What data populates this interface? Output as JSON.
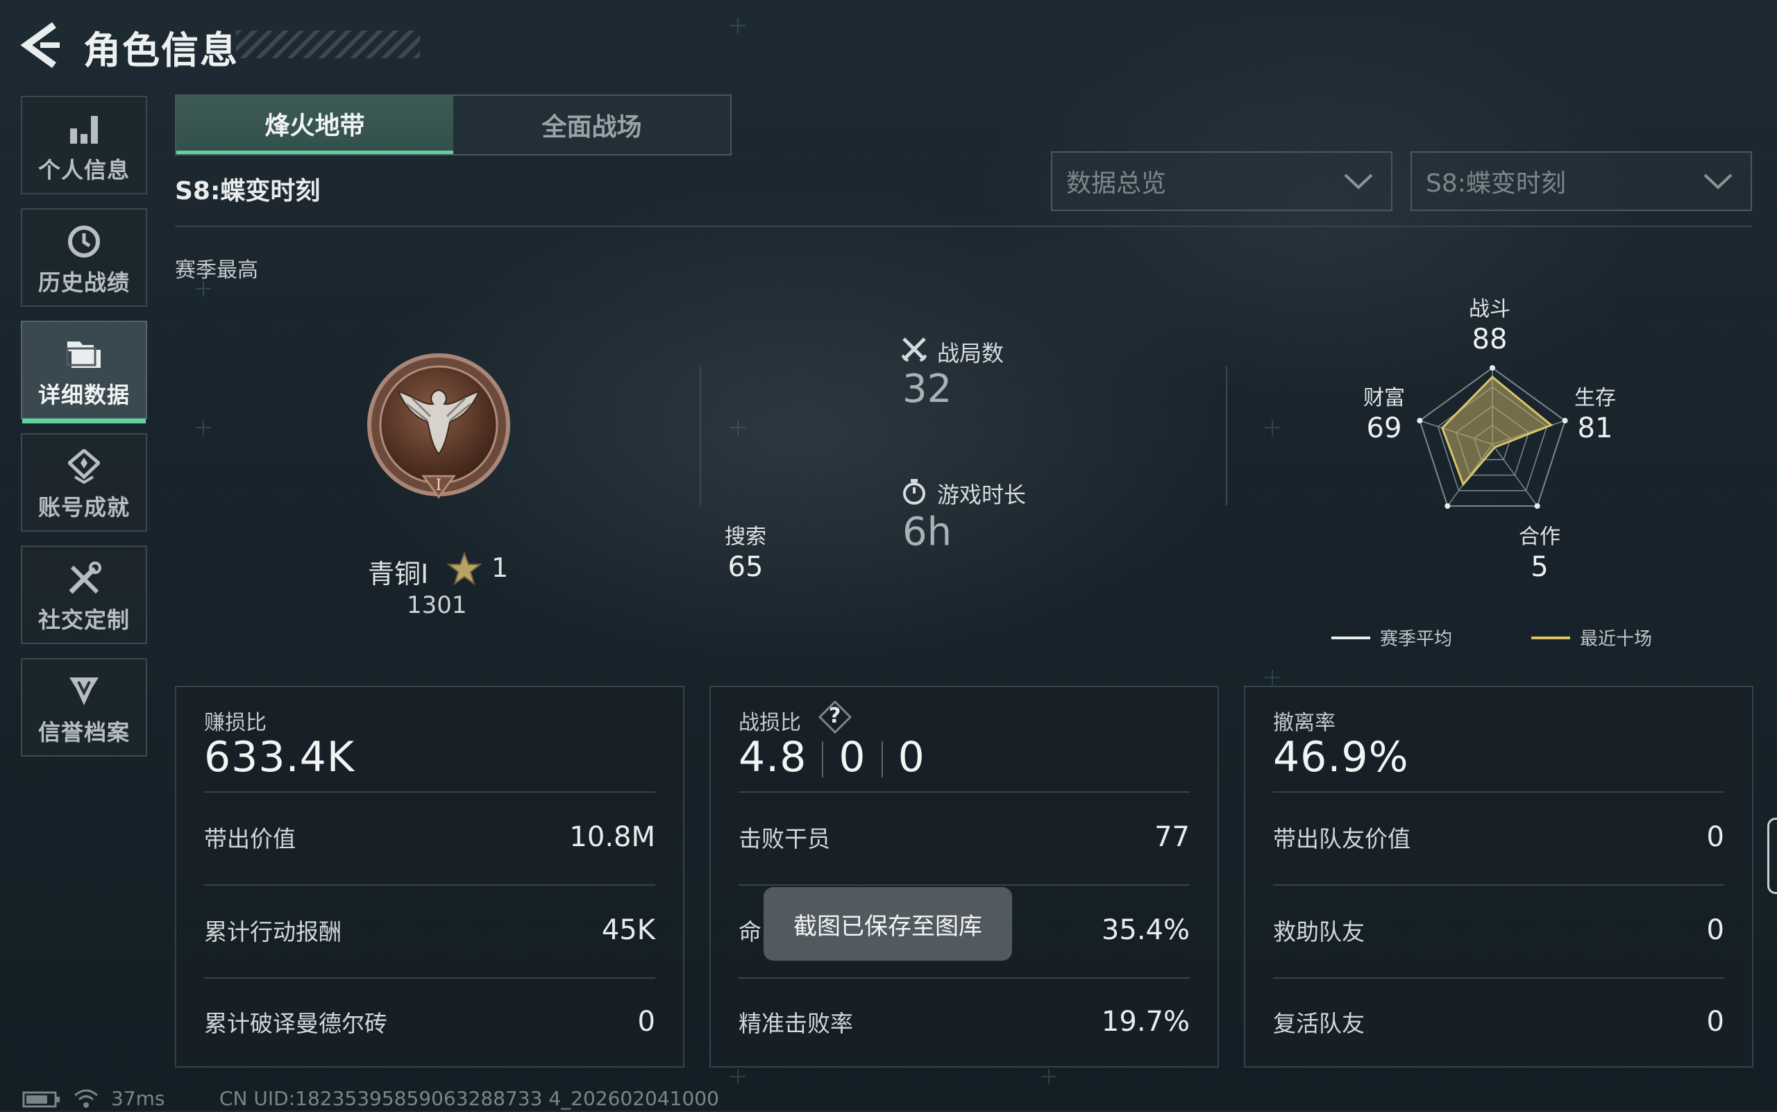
{
  "header": {
    "title": "角色信息"
  },
  "sidebar": {
    "items": [
      {
        "label": "个人信息",
        "icon": "bar-chart-icon"
      },
      {
        "label": "历史战绩",
        "icon": "history-clock-icon"
      },
      {
        "label": "详细数据",
        "icon": "folder-data-icon",
        "active": true
      },
      {
        "label": "账号成就",
        "icon": "achievement-badge-icon"
      },
      {
        "label": "社交定制",
        "icon": "tools-icon"
      },
      {
        "label": "信誉档案",
        "icon": "shield-badge-icon"
      }
    ]
  },
  "tabs": [
    {
      "label": "烽火地带",
      "active": true
    },
    {
      "label": "全面战场"
    }
  ],
  "season_title": "S8:蝶变时刻",
  "filters": {
    "view": "数据总览",
    "season": "S8:蝶变时刻"
  },
  "section_label": "赛季最高",
  "rank": {
    "name": "青铜I",
    "stars": "1",
    "score": "1301",
    "emblem_icon": "bronze-eagle-emblem-icon"
  },
  "stats": {
    "matches_label": "战局数",
    "matches_value": "32",
    "playtime_label": "游戏时长",
    "playtime_value": "6h"
  },
  "radar": {
    "axes": [
      {
        "label": "战斗",
        "value": "88"
      },
      {
        "label": "生存",
        "value": "81"
      },
      {
        "label": "合作",
        "value": "5"
      },
      {
        "label": "搜索",
        "value": "65"
      },
      {
        "label": "财富",
        "value": "69"
      }
    ],
    "recent_values": [
      88,
      81,
      5,
      65,
      69
    ],
    "legend": {
      "season_avg": "赛季平均",
      "recent_ten": "最近十场"
    },
    "colors": {
      "season_avg": "#e8ecec",
      "recent_ten": "#d9c46a"
    }
  },
  "cards": {
    "profit": {
      "title": "赚损比",
      "value": "633.4K",
      "rows": [
        {
          "label": "带出价值",
          "value": "10.8M"
        },
        {
          "label": "累计行动报酬",
          "value": "45K"
        },
        {
          "label": "累计破译曼德尔砖",
          "value": "0"
        }
      ]
    },
    "combat": {
      "title": "战损比",
      "help": "?",
      "kd": [
        "4.8",
        "0",
        "0"
      ],
      "rows": [
        {
          "label": "击败干员",
          "value": "77"
        },
        {
          "label": "命",
          "value": "35.4%"
        },
        {
          "label": "精准击败率",
          "value": "19.7%"
        }
      ]
    },
    "extract": {
      "title": "撤离率",
      "value": "46.9%",
      "rows": [
        {
          "label": "带出队友价值",
          "value": "0"
        },
        {
          "label": "救助队友",
          "value": "0"
        },
        {
          "label": "复活队友",
          "value": "0"
        }
      ]
    }
  },
  "toast": "截图已保存至图库",
  "footer": {
    "ping": "37ms",
    "uid": "CN UID:18235395859063288733 4_202602041000"
  },
  "accent_color": "#5fd39a"
}
